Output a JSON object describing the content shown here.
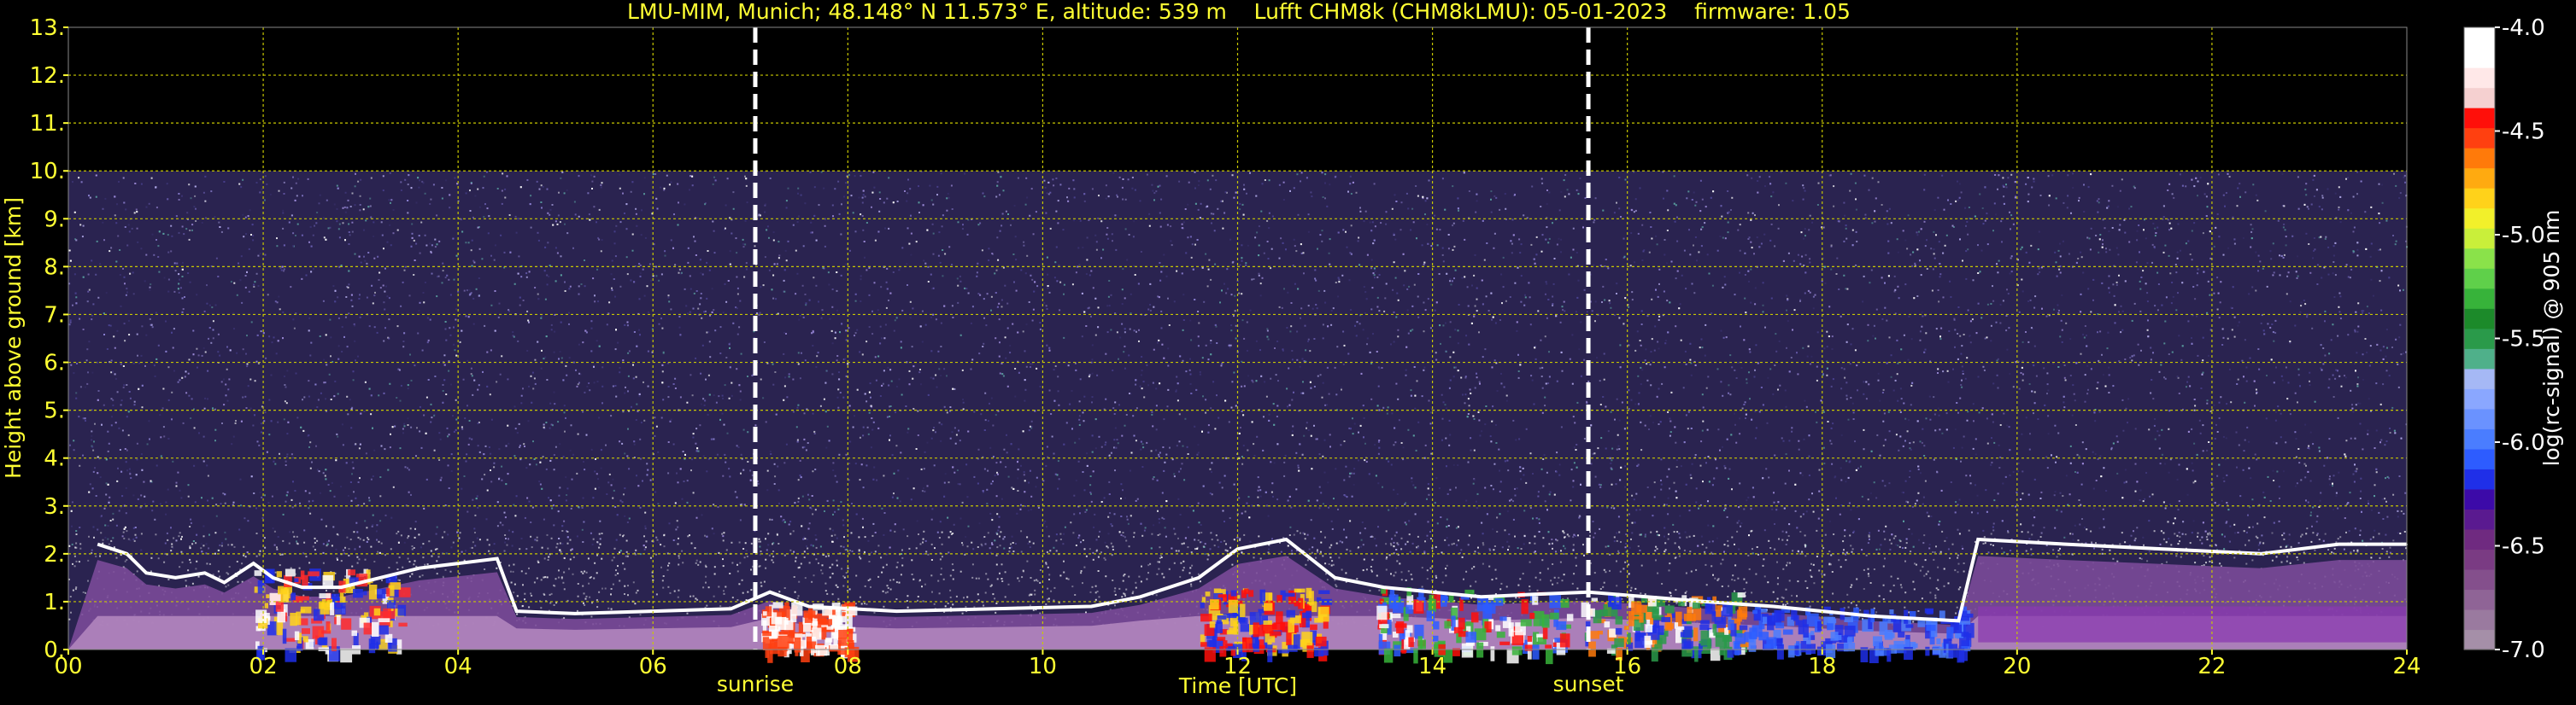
{
  "chart_data": {
    "type": "heatmap",
    "title": "LMU-MIM, Munich; 48.148° N 11.573° E, altitude: 539 m    Lufft CHM8k (CHM8kLMU): 05-01-2023    firmware: 1.05",
    "xlabel": "Time [UTC]",
    "ylabel": "Height above ground [km]",
    "xlim": [
      0,
      24
    ],
    "ylim": [
      0,
      13
    ],
    "x_ticks": [
      {
        "value": 0,
        "label": "00"
      },
      {
        "value": 2,
        "label": "02"
      },
      {
        "value": 4,
        "label": "04"
      },
      {
        "value": 6,
        "label": "06"
      },
      {
        "value": 8,
        "label": "08"
      },
      {
        "value": 10,
        "label": "10"
      },
      {
        "value": 12,
        "label": "12"
      },
      {
        "value": 14,
        "label": "14"
      },
      {
        "value": 16,
        "label": "16"
      },
      {
        "value": 18,
        "label": "18"
      },
      {
        "value": 20,
        "label": "20"
      },
      {
        "value": 22,
        "label": "22"
      },
      {
        "value": 24,
        "label": "24"
      }
    ],
    "y_ticks": [
      {
        "value": 0,
        "label": "0."
      },
      {
        "value": 1,
        "label": "1."
      },
      {
        "value": 2,
        "label": "2."
      },
      {
        "value": 3,
        "label": "3."
      },
      {
        "value": 4,
        "label": "4."
      },
      {
        "value": 5,
        "label": "5."
      },
      {
        "value": 6,
        "label": "6."
      },
      {
        "value": 7,
        "label": "7."
      },
      {
        "value": 8,
        "label": "8."
      },
      {
        "value": 9,
        "label": "9."
      },
      {
        "value": 10,
        "label": "10."
      },
      {
        "value": 11,
        "label": "11."
      },
      {
        "value": 12,
        "label": "12."
      },
      {
        "value": 13,
        "label": "13."
      }
    ],
    "grid": true,
    "measurement_ceiling_km": 10,
    "annotations": [
      {
        "label": "sunrise",
        "x": 7.05
      },
      {
        "label": "sunset",
        "x": 15.6
      }
    ],
    "boundary_layer": [
      {
        "t": 0.3,
        "h": 2.2
      },
      {
        "t": 0.6,
        "h": 2.0
      },
      {
        "t": 0.8,
        "h": 1.6
      },
      {
        "t": 1.1,
        "h": 1.5
      },
      {
        "t": 1.4,
        "h": 1.6
      },
      {
        "t": 1.6,
        "h": 1.4
      },
      {
        "t": 1.9,
        "h": 1.8
      },
      {
        "t": 2.1,
        "h": 1.5
      },
      {
        "t": 2.4,
        "h": 1.3
      },
      {
        "t": 2.8,
        "h": 1.3
      },
      {
        "t": 3.2,
        "h": 1.5
      },
      {
        "t": 3.6,
        "h": 1.7
      },
      {
        "t": 4.0,
        "h": 1.8
      },
      {
        "t": 4.4,
        "h": 1.9
      },
      {
        "t": 4.6,
        "h": 0.8
      },
      {
        "t": 5.2,
        "h": 0.75
      },
      {
        "t": 6.0,
        "h": 0.8
      },
      {
        "t": 6.8,
        "h": 0.85
      },
      {
        "t": 7.2,
        "h": 1.2
      },
      {
        "t": 7.6,
        "h": 0.9
      },
      {
        "t": 8.5,
        "h": 0.8
      },
      {
        "t": 9.5,
        "h": 0.85
      },
      {
        "t": 10.5,
        "h": 0.9
      },
      {
        "t": 11.0,
        "h": 1.1
      },
      {
        "t": 11.6,
        "h": 1.5
      },
      {
        "t": 12.0,
        "h": 2.1
      },
      {
        "t": 12.5,
        "h": 2.3
      },
      {
        "t": 13.0,
        "h": 1.5
      },
      {
        "t": 13.5,
        "h": 1.3
      },
      {
        "t": 14.0,
        "h": 1.2
      },
      {
        "t": 14.5,
        "h": 1.1
      },
      {
        "t": 15.0,
        "h": 1.15
      },
      {
        "t": 15.6,
        "h": 1.2
      },
      {
        "t": 16.2,
        "h": 1.1
      },
      {
        "t": 16.8,
        "h": 1.0
      },
      {
        "t": 17.5,
        "h": 0.9
      },
      {
        "t": 18.5,
        "h": 0.7
      },
      {
        "t": 19.4,
        "h": 0.6
      },
      {
        "t": 19.6,
        "h": 2.3
      },
      {
        "t": 20.5,
        "h": 2.2
      },
      {
        "t": 21.5,
        "h": 2.1
      },
      {
        "t": 22.5,
        "h": 2.0
      },
      {
        "t": 23.3,
        "h": 2.2
      },
      {
        "t": 24.0,
        "h": 2.2
      }
    ],
    "colorbar": {
      "label": "log(rc-signal) @ 905 nm",
      "range": [
        -7.0,
        -4.0
      ],
      "ticks": [
        {
          "value": -4.0,
          "label": "-4.0"
        },
        {
          "value": -4.5,
          "label": "-4.5"
        },
        {
          "value": -5.0,
          "label": "-5.0"
        },
        {
          "value": -5.5,
          "label": "-5.5"
        },
        {
          "value": -6.0,
          "label": "-6.0"
        },
        {
          "value": -6.5,
          "label": "-6.5"
        },
        {
          "value": -7.0,
          "label": "-7.0"
        }
      ],
      "colors": [
        "#a58fa8",
        "#9a7a9f",
        "#8f6496",
        "#844f8c",
        "#7a3b83",
        "#6f2a80",
        "#5a1a90",
        "#3c0aa8",
        "#1f2fe8",
        "#2d5cff",
        "#4a7dff",
        "#6a92ff",
        "#8aa7ff",
        "#a5b8f5",
        "#4fb08a",
        "#2a9a4a",
        "#1c8a2a",
        "#37b33a",
        "#5fd04a",
        "#8ae24a",
        "#c9ef3a",
        "#f2f02a",
        "#ffd21a",
        "#ffaa10",
        "#ff7a0a",
        "#ff4010",
        "#ff0f0a",
        "#f5d0d0",
        "#ffe8e8",
        "#ffffff",
        "#ffffff"
      ]
    }
  }
}
